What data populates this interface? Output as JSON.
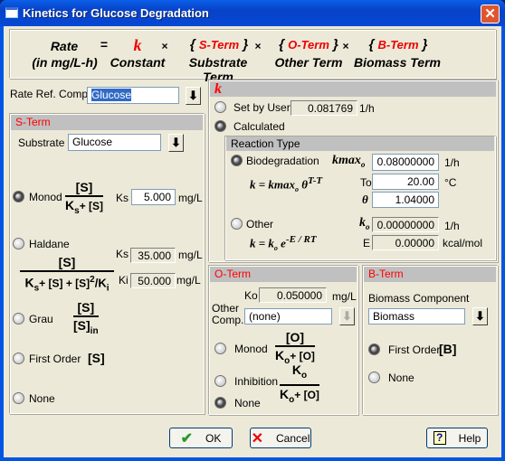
{
  "window": {
    "title": "Kinetics for Glucose Degradation",
    "close_label": "✕"
  },
  "equation": {
    "rate": "Rate",
    "rate_unit": "(in mg/L-h)",
    "equals": "=",
    "times": "×",
    "k": "k",
    "k_caption": "Constant",
    "s_term": "S-Term",
    "s_caption": "Substrate Term",
    "o_term": "O-Term",
    "o_caption": "Other Term",
    "b_term": "B-Term",
    "b_caption": "Biomass Term"
  },
  "rate_ref": {
    "label": "Rate Ref. Comp.",
    "value": "Glucose"
  },
  "s_term": {
    "header": "S-Term",
    "substrate_label": "Substrate",
    "substrate_value": "Glucose",
    "options": [
      {
        "label": "Monod",
        "selected": true
      },
      {
        "label": "Haldane",
        "selected": false
      },
      {
        "label": "Grau",
        "selected": false
      },
      {
        "label": "First Order",
        "selected": false
      },
      {
        "label": "None",
        "selected": false
      }
    ],
    "monod_ks_label": "Ks",
    "monod_ks": "5.000",
    "haldane_ks_label": "Ks",
    "haldane_ks": "35.000",
    "haldane_ki_label": "Ki",
    "haldane_ki": "50.000",
    "unit": "mg/L",
    "f_S": "[S]",
    "f_Ks": "K",
    "f_s_sub": "s",
    "f_plusS": "+ [S]",
    "f_plusS2": "+ [S] + [S]",
    "f_sq": "2",
    "f_slashKi": "/K",
    "f_i": "i",
    "f_in": "in"
  },
  "k_section": {
    "header": "k",
    "set_by_user": "Set by User",
    "set_value": "0.081769",
    "set_unit": "1/h",
    "calculated": "Calculated",
    "set_selected": false,
    "calculated_selected": true,
    "reaction_type": "Reaction Type",
    "biodegradation": "Biodegradation",
    "bio_selected": true,
    "kmax_label": "kmax",
    "kmax": "0.08000000",
    "kmax_unit": "1/h",
    "bio_formula": "k = kmax",
    "bio_formula_exp": "T-T",
    "theta_sym": "θ",
    "to_label": "To",
    "to": "20.00",
    "to_unit": "°C",
    "theta": "1.04000",
    "other": "Other",
    "other_selected": false,
    "k0_label": "k",
    "k0": "0.00000000",
    "k0_unit": "1/h",
    "other_formula": "k = k",
    "other_formula_e": "e",
    "other_formula_exp": "-E / RT",
    "e_label": "E",
    "e": "0.00000",
    "e_unit": "kcal/mol",
    "sub0": "o"
  },
  "o_term": {
    "header": "O-Term",
    "ko_label": "Ko",
    "ko": "0.050000",
    "ko_unit": "mg/L",
    "other_comp_label1": "Other",
    "other_comp_label2": "Comp.",
    "other_comp": "(none)",
    "options": [
      {
        "label": "Monod",
        "selected": false
      },
      {
        "label": "Inhibition",
        "selected": false
      },
      {
        "label": "None",
        "selected": true
      }
    ],
    "f_O": "[O]",
    "f_K": "K",
    "f_o": "o",
    "f_plusO": "+ [O]"
  },
  "b_term": {
    "header": "B-Term",
    "component_label": "Biomass Component",
    "component": "Biomass",
    "options": [
      {
        "label": "First Order",
        "selected": true
      },
      {
        "label": "None",
        "selected": false
      }
    ],
    "f_B": "[B]"
  },
  "buttons": {
    "ok": "OK",
    "cancel": "Cancel",
    "help": "Help"
  }
}
